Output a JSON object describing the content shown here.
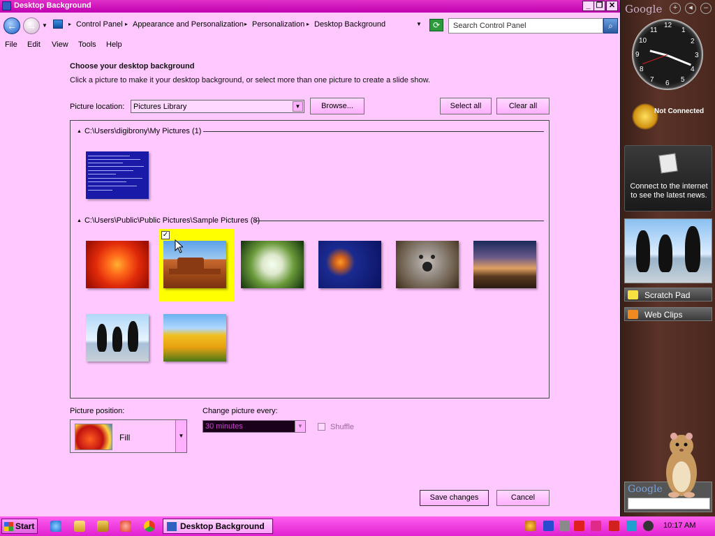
{
  "window": {
    "title": "Desktop Background",
    "controls": {
      "minimize": "_",
      "maximize": "❐",
      "close": "✕"
    }
  },
  "address": {
    "crumbs": [
      "Control Panel",
      "Appearance and Personalization",
      "Personalization",
      "Desktop Background"
    ],
    "search_placeholder": "Search Control Panel"
  },
  "menu": [
    "File",
    "Edit",
    "View",
    "Tools",
    "Help"
  ],
  "page": {
    "heading": "Choose your desktop background",
    "description": "Click a picture to make it your desktop background, or select more than one picture to create a slide show.",
    "location_label": "Picture location:",
    "location_value": "Pictures Library",
    "browse_label": "Browse...",
    "select_all_label": "Select all",
    "clear_all_label": "Clear all"
  },
  "gallery": {
    "groups": [
      {
        "header": "C:\\Users\\digibrony\\My Pictures (1)",
        "items": [
          "blue-screen"
        ]
      },
      {
        "header": "C:\\Users\\Public\\Public Pictures\\Sample Pictures (8)",
        "items": [
          "chrysanthemum",
          "desert",
          "hydrangeas",
          "jellyfish",
          "koala",
          "lighthouse",
          "penguins",
          "tulips"
        ],
        "selected": "desert"
      }
    ]
  },
  "position": {
    "label": "Picture position:",
    "value": "Fill"
  },
  "change": {
    "label": "Change picture every:",
    "value": "30 minutes",
    "shuffle_label": "Shuffle",
    "shuffle_checked": false
  },
  "actions": {
    "save_label": "Save changes",
    "cancel_label": "Cancel"
  },
  "taskbar": {
    "start_label": "Start",
    "active_task": "Desktop Background",
    "clock": "10:17 AM"
  },
  "sidebar": {
    "brand": "Google",
    "controls": [
      "+",
      "◂",
      "–"
    ],
    "clock_numbers": [
      "12",
      "1",
      "2",
      "3",
      "4",
      "5",
      "6",
      "7",
      "8",
      "9",
      "10",
      "11"
    ],
    "weather_status": "Not Connected",
    "news_text": "Connect to the internet to see the latest news.",
    "scratch_pad": "Scratch Pad",
    "web_clips": "Web Clips",
    "search_brand": "Google"
  },
  "colors": {
    "window_bg": "#ffc8ff",
    "titlebar": "#c000b0",
    "taskbar": "#e020d0",
    "selection_highlight": "#ffff00"
  }
}
